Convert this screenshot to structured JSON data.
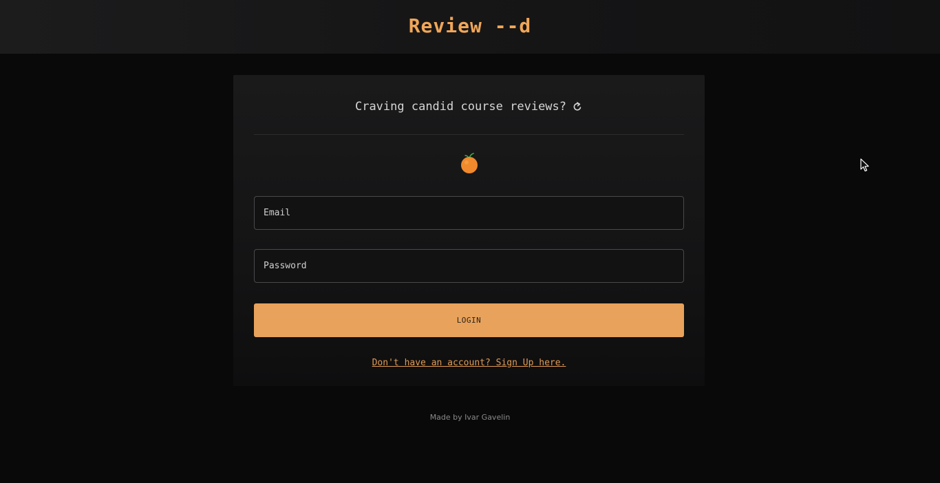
{
  "header": {
    "logo": "Review --d"
  },
  "login_card": {
    "tagline": "Craving candid course reviews?",
    "refresh_icon": "refresh-icon",
    "logo_icon": "orange-icon",
    "email": {
      "placeholder": "Email",
      "value": ""
    },
    "password": {
      "placeholder": "Password",
      "value": ""
    },
    "login_label": "LOGIN",
    "signup_text": "Don't have an account? Sign Up here."
  },
  "footer": {
    "text": "Made by Ivar Gavelin"
  },
  "colors": {
    "accent": "#e8a25b",
    "link": "#e09a55",
    "background": "#09090a",
    "card": "#161617"
  }
}
